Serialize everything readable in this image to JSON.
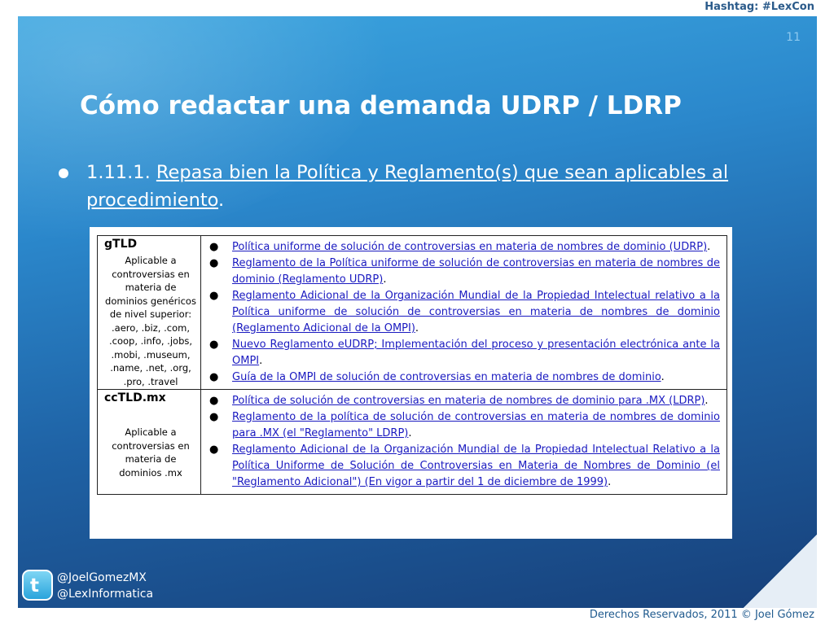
{
  "hashtag": "Hashtag: #LexCon",
  "slide_number": "11",
  "title": "Cómo redactar una demanda UDRP / LDRP",
  "bullet": {
    "number": "1.11.1.",
    "link_text": "Repasa bien la Política y Reglamento(s) que sean aplicables al procedimiento",
    "end": "."
  },
  "table": {
    "rows": [
      {
        "name": "gTLD",
        "description": "Aplicable a controversias en materia de dominios genéricos de nivel superior: .aero, .biz, .com, .coop, .info, .jobs, .mobi, .museum, .name, .net, .org, .pro, .travel",
        "items": [
          {
            "link": "Política uniforme de solución de controversias en materia de nombres de dominio (UDRP)",
            "suffix": "."
          },
          {
            "link": "Reglamento de la Política uniforme de solución de controversias en materia de nombres de dominio (Reglamento UDRP)",
            "suffix": "."
          },
          {
            "link": "Reglamento Adicional de la Organización Mundial de la Propiedad Intelectual relativo a la Política uniforme de solución de controversias en materia de nombres de dominio (Reglamento Adicional de la OMPI)",
            "suffix": "."
          },
          {
            "link": "Nuevo Reglamento eUDRP; Implementación del proceso y presentación electrónica ante la OMPI",
            "suffix": "."
          },
          {
            "link": "Guía de la OMPI de solución de controversias en materia de nombres de dominio",
            "suffix": "."
          }
        ]
      },
      {
        "name": "ccTLD.mx",
        "description": "Aplicable a controversias en materia de dominios .mx",
        "items": [
          {
            "link": "Política de solución de controversias en materia de nombres de dominio para .MX (LDRP)",
            "suffix": "."
          },
          {
            "link": "Reglamento de la política de solución de controversias en materia de nombres de dominio para .MX (el \"Reglamento\" LDRP)",
            "suffix": "."
          },
          {
            "link": "Reglamento Adicional de la Organización Mundial de la Propiedad Intelectual Relativo a la Política Uniforme de Solución de Controversias en Materia de Nombres de Dominio (el \"Reglamento Adicional\") (En vigor a partir del 1 de diciembre de 1999)",
            "suffix": "."
          }
        ]
      }
    ]
  },
  "social": {
    "icon": "twitter-icon",
    "handle_1": "@JoelGomezMX",
    "handle_2": "@LexInformatica"
  },
  "footer": "Derechos Reservados, 2011 © Joel Gómez",
  "colors": {
    "slide_top": "#3ca6e0",
    "slide_bottom": "#17407a",
    "link": "#1a1ac0",
    "hashtag": "#2a5a8a"
  }
}
